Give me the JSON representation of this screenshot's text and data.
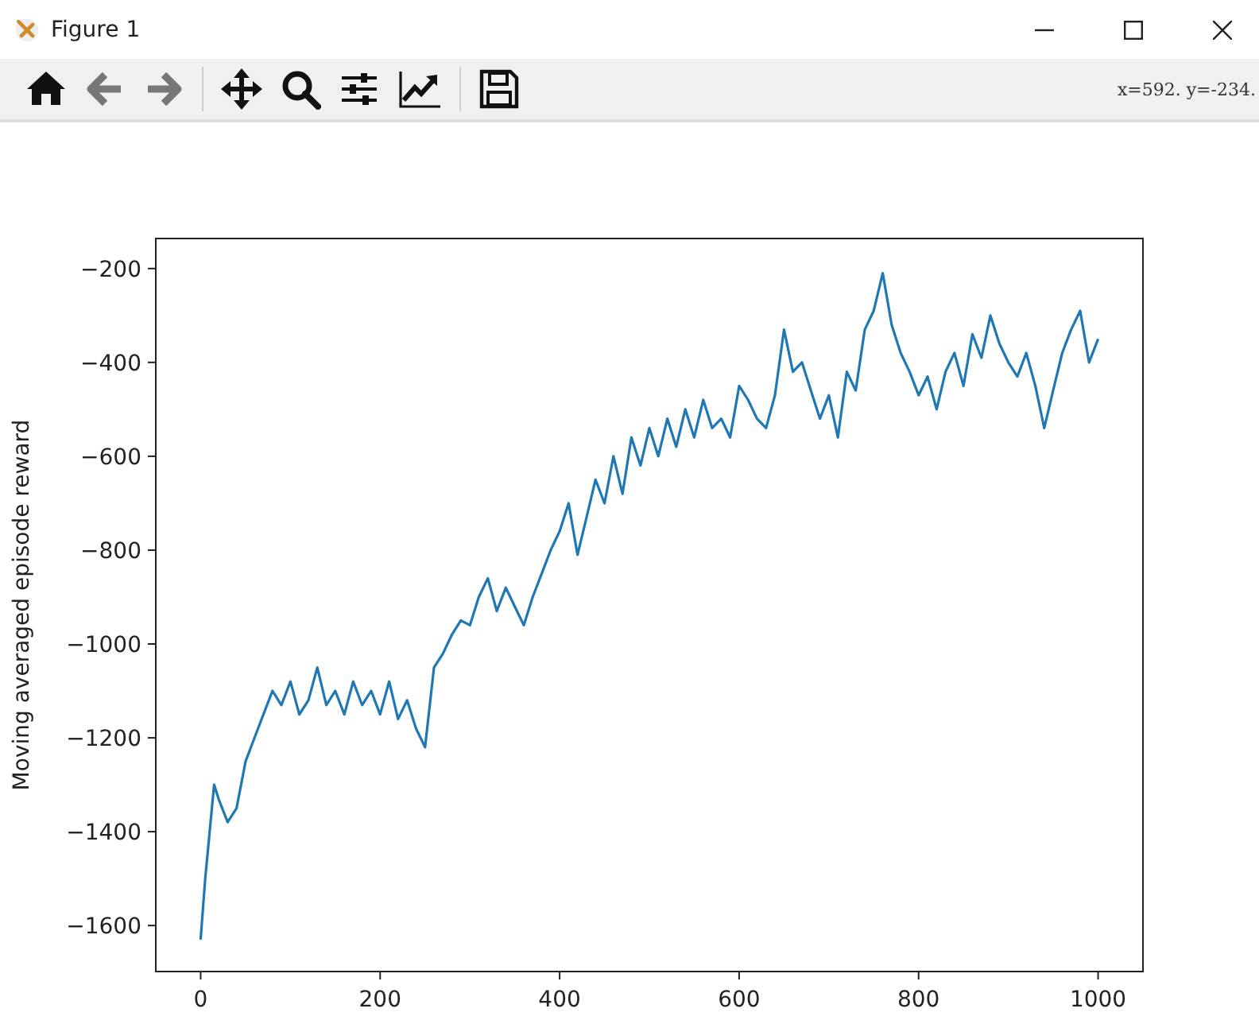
{
  "window": {
    "title": "Figure 1"
  },
  "toolbar": {
    "buttons": [
      {
        "kind": "home",
        "disabled": false
      },
      {
        "kind": "back",
        "disabled": true
      },
      {
        "kind": "forward",
        "disabled": true
      },
      {
        "kind": "pan",
        "disabled": false
      },
      {
        "kind": "zoom",
        "disabled": false
      },
      {
        "kind": "subplots",
        "disabled": false
      },
      {
        "kind": "customize",
        "disabled": false
      },
      {
        "kind": "save",
        "disabled": false
      }
    ],
    "coordinates": "x=592.  y=-234."
  },
  "figure": {
    "chart_data": {
      "type": "line",
      "ylabel": "Moving averaged episode reward",
      "xlim": [
        -50,
        1050
      ],
      "ylim": [
        -1698,
        -136
      ],
      "xticks": [
        0,
        200,
        400,
        600,
        800,
        1000
      ],
      "yticks": [
        {
          "value": -1600,
          "label": "−1600"
        },
        {
          "value": -1400,
          "label": "−1400"
        },
        {
          "value": -1200,
          "label": "−1200"
        },
        {
          "value": -1000,
          "label": "−1000"
        },
        {
          "value": -800,
          "label": "−800"
        },
        {
          "value": -600,
          "label": "−600"
        },
        {
          "value": -400,
          "label": "−400"
        },
        {
          "value": -200,
          "label": "−200"
        }
      ],
      "x": [
        0,
        5,
        10,
        15,
        20,
        30,
        40,
        50,
        60,
        70,
        80,
        90,
        100,
        110,
        120,
        130,
        140,
        150,
        160,
        170,
        180,
        190,
        200,
        210,
        220,
        230,
        240,
        250,
        260,
        270,
        280,
        290,
        300,
        310,
        320,
        330,
        340,
        350,
        360,
        370,
        380,
        390,
        400,
        410,
        420,
        430,
        440,
        450,
        460,
        470,
        480,
        490,
        500,
        510,
        520,
        530,
        540,
        550,
        560,
        570,
        580,
        590,
        600,
        610,
        620,
        630,
        640,
        650,
        660,
        670,
        680,
        690,
        700,
        710,
        720,
        730,
        740,
        750,
        760,
        770,
        780,
        790,
        800,
        810,
        820,
        830,
        840,
        850,
        860,
        870,
        880,
        890,
        900,
        910,
        920,
        930,
        940,
        950,
        960,
        970,
        980,
        990,
        1000
      ],
      "series": [
        {
          "color": "#1f77b4",
          "values": [
            -1630,
            -1500,
            -1400,
            -1300,
            -1330,
            -1380,
            -1350,
            -1250,
            -1200,
            -1150,
            -1100,
            -1130,
            -1080,
            -1150,
            -1120,
            -1050,
            -1130,
            -1100,
            -1150,
            -1080,
            -1130,
            -1100,
            -1150,
            -1080,
            -1160,
            -1120,
            -1180,
            -1220,
            -1050,
            -1020,
            -980,
            -950,
            -960,
            -900,
            -860,
            -930,
            -880,
            -920,
            -960,
            -900,
            -850,
            -800,
            -760,
            -700,
            -810,
            -730,
            -650,
            -700,
            -600,
            -680,
            -560,
            -620,
            -540,
            -600,
            -520,
            -580,
            -500,
            -560,
            -480,
            -540,
            -520,
            -560,
            -450,
            -480,
            -520,
            -540,
            -470,
            -330,
            -420,
            -400,
            -460,
            -520,
            -470,
            -560,
            -420,
            -460,
            -330,
            -290,
            -210,
            -320,
            -380,
            -420,
            -470,
            -430,
            -500,
            -420,
            -380,
            -450,
            -340,
            -390,
            -300,
            -360,
            -400,
            -430,
            -380,
            -450,
            -540,
            -460,
            -380,
            -330,
            -290,
            -400,
            -350
          ]
        }
      ]
    }
  }
}
